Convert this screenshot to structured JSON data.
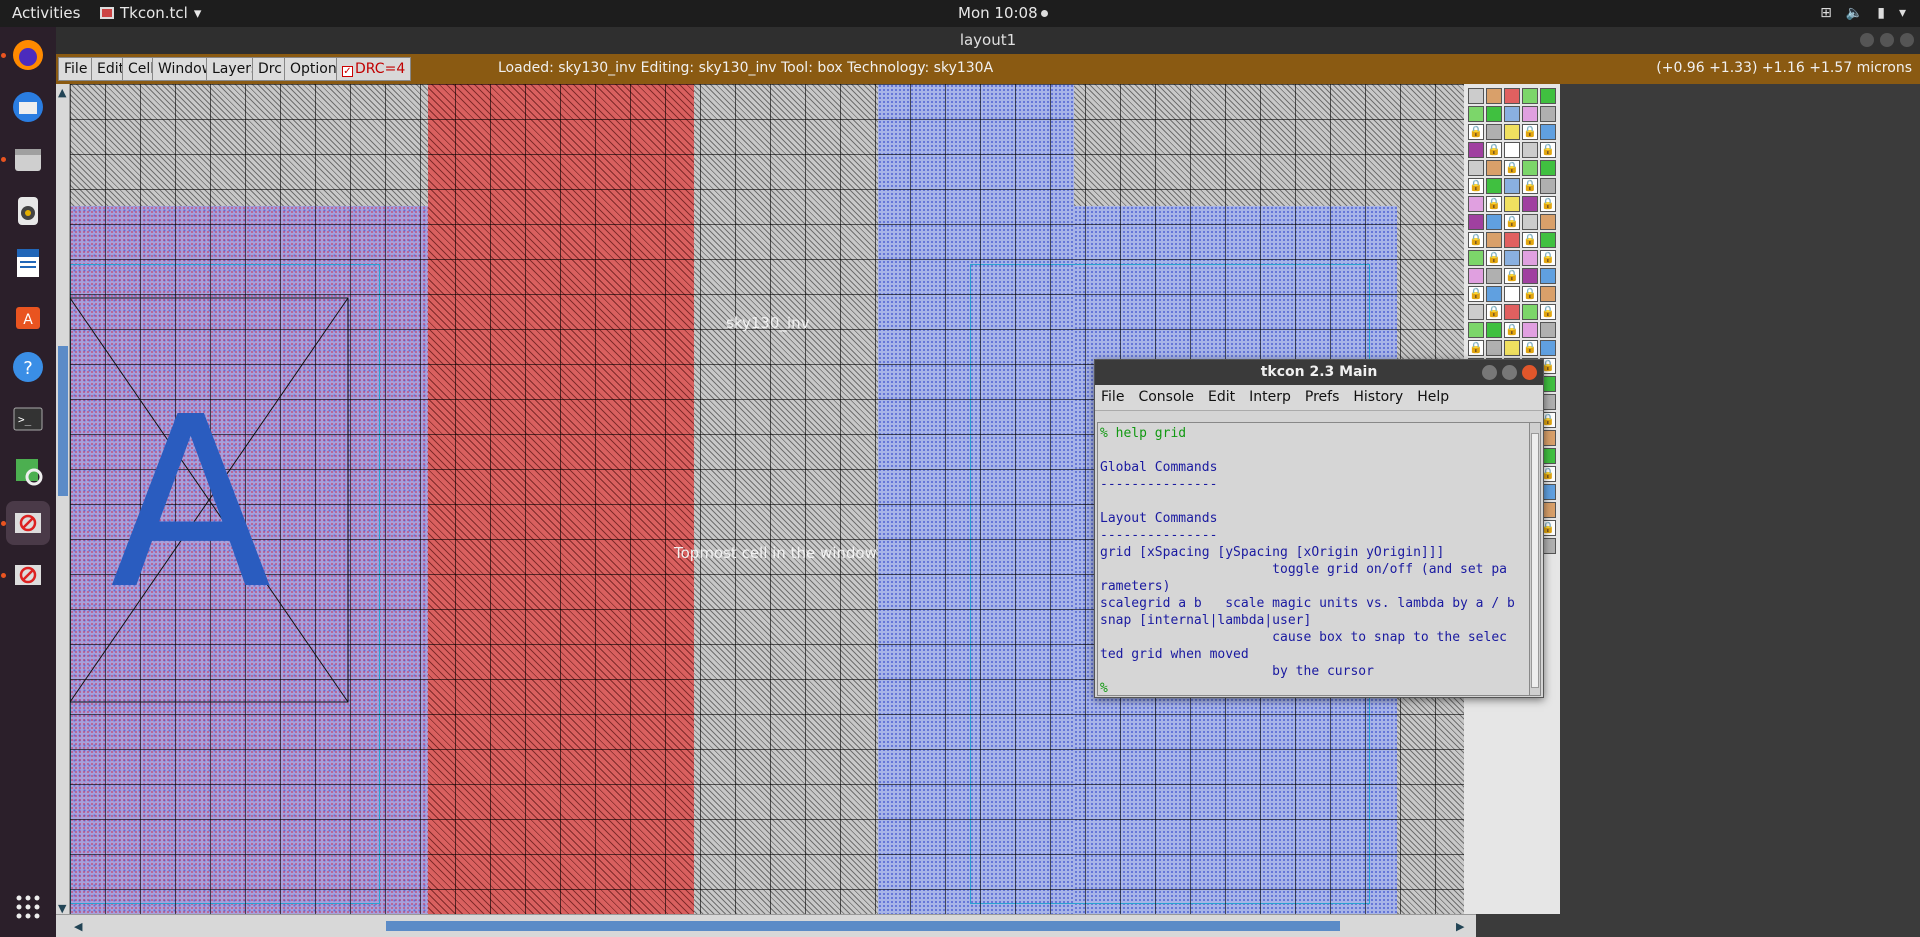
{
  "topbar": {
    "activities": "Activities",
    "app_name": "Tkcon.tcl",
    "clock": "Mon 10:08"
  },
  "dock": {
    "items": [
      "firefox-icon",
      "thunderbird-icon",
      "files-icon",
      "rhythmbox-icon",
      "writer-icon",
      "software-icon",
      "help-icon",
      "terminal-icon",
      "image-viewer-icon",
      "blocked-app-icon",
      "blocked-app-icon"
    ]
  },
  "magic": {
    "window_title": "layout1",
    "menu": [
      "File",
      "Edit",
      "Cell",
      "Window",
      "Layers",
      "Drc",
      "Options"
    ],
    "drc_label": "DRC=4",
    "status": "Loaded: sky130_inv Editing: sky130_inv Tool: box  Technology: sky130A",
    "coords": "(+0.96 +1.33) +1.16 +1.57 microns",
    "canvas": {
      "label_top": "sky130_inv",
      "label_cell": "Topmost cell in the window",
      "big_label": "A"
    }
  },
  "tkcon": {
    "title": "tkcon 2.3 Main",
    "menu": [
      "File",
      "Console",
      "Edit",
      "Interp",
      "Prefs",
      "History",
      "Help"
    ],
    "prompt_line": "% help grid",
    "lines": [
      "",
      "Global Commands",
      "---------------",
      "",
      "Layout Commands",
      "---------------",
      "grid [xSpacing [ySpacing [xOrigin yOrigin]]]",
      "                      toggle grid on/off (and set pa",
      "rameters)",
      "scalegrid a b   scale magic units vs. lambda by a / b",
      "snap [internal|lambda|user]",
      "                      cause box to snap to the selec",
      "ted grid when moved",
      "                      by the cursor"
    ],
    "trailing_prompt": "%"
  }
}
